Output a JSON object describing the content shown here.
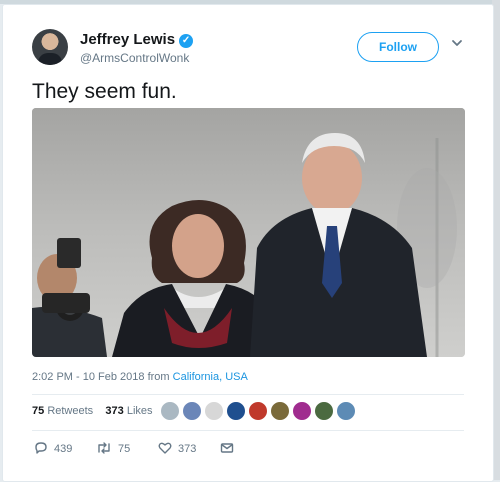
{
  "author": {
    "name": "Jeffrey Lewis",
    "handle": "@ArmsControlWonk",
    "verified_glyph": "✓"
  },
  "follow_label": "Follow",
  "tweet_text": "They seem fun.",
  "timestamp": "2:02 PM - 10 Feb 2018 from ",
  "location": "California, USA",
  "stats": {
    "retweets_count": "75",
    "retweets_label": "Retweets",
    "likes_count": "373",
    "likes_label": "Likes"
  },
  "actions": {
    "reply_count": "439",
    "retweet_count": "75",
    "like_count": "373"
  },
  "colors": {
    "accent": "#1da1f2",
    "muted": "#657786",
    "link": "#1b95e0"
  }
}
